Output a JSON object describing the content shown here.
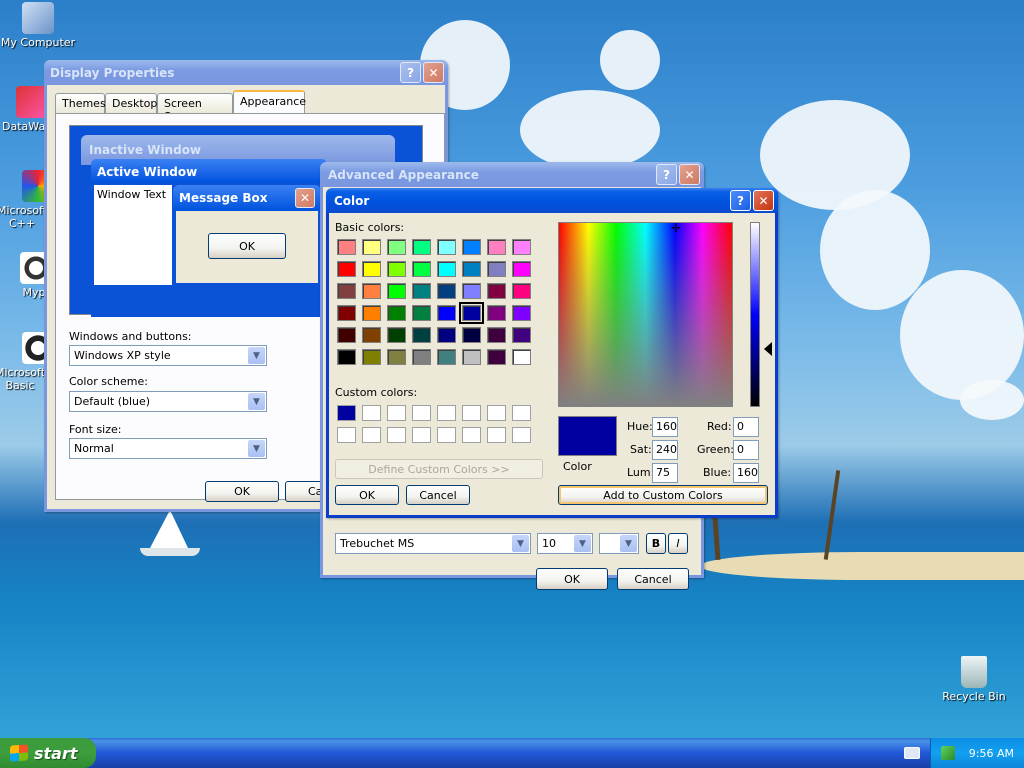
{
  "desktop": {
    "icons": [
      {
        "label": "My Computer"
      },
      {
        "label": "DataWa"
      },
      {
        "label": "Microsoft C++"
      },
      {
        "label": "Myp"
      },
      {
        "label": "Microsoft Basic"
      },
      {
        "label": "Recycle Bin"
      }
    ]
  },
  "display_properties": {
    "title": "Display Properties",
    "tabs": [
      "Themes",
      "Desktop",
      "Screen Saver",
      "Appearance"
    ],
    "active_tab": "Appearance",
    "preview": {
      "inactive_title": "Inactive Window",
      "active_title": "Active Window",
      "window_text": "Window Text",
      "message_box_title": "Message Box",
      "message_ok": "OK"
    },
    "windows_buttons_label": "Windows and buttons:",
    "windows_buttons_value": "Windows XP style",
    "color_scheme_label": "Color scheme:",
    "color_scheme_value": "Default (blue)",
    "font_size_label": "Font size:",
    "font_size_value": "Normal",
    "ok": "OK",
    "cancel": "Ca"
  },
  "advanced_appearance": {
    "title": "Advanced Appearance",
    "font_value": "Trebuchet MS",
    "size_value": "10",
    "bold": "B",
    "italic": "I",
    "ok": "OK",
    "cancel": "Cancel"
  },
  "color_dialog": {
    "title": "Color",
    "basic_colors_label": "Basic colors:",
    "basic_colors": [
      [
        "#ff8080",
        "#ffff80",
        "#80ff80",
        "#00ff80",
        "#80ffff",
        "#0080ff",
        "#ff80c0",
        "#ff80ff"
      ],
      [
        "#ff0000",
        "#ffff00",
        "#80ff00",
        "#00ff40",
        "#00ffff",
        "#0080c0",
        "#8080c0",
        "#ff00ff"
      ],
      [
        "#804040",
        "#ff8040",
        "#00ff00",
        "#008080",
        "#004080",
        "#8080ff",
        "#800040",
        "#ff0080"
      ],
      [
        "#800000",
        "#ff8000",
        "#008000",
        "#008040",
        "#0000ff",
        "#0000a0",
        "#800080",
        "#8000ff"
      ],
      [
        "#400000",
        "#804000",
        "#004000",
        "#004040",
        "#000080",
        "#000040",
        "#400040",
        "#400080"
      ],
      [
        "#000000",
        "#808000",
        "#808040",
        "#808080",
        "#408080",
        "#c0c0c0",
        "#400040",
        "#ffffff"
      ]
    ],
    "selected_basic": "#0000a0",
    "custom_colors_label": "Custom colors:",
    "custom_colors": [
      "#0000a0",
      "#ffffff",
      "#ffffff",
      "#ffffff",
      "#ffffff",
      "#ffffff",
      "#ffffff",
      "#ffffff",
      "#ffffff",
      "#ffffff",
      "#ffffff",
      "#ffffff",
      "#ffffff",
      "#ffffff",
      "#ffffff",
      "#ffffff"
    ],
    "define_custom": "Define Custom Colors >>",
    "ok": "OK",
    "cancel": "Cancel",
    "color_label": "Color",
    "current_color": "#0000a0",
    "hue_label": "Hue:",
    "hue": "160",
    "sat_label": "Sat:",
    "sat": "240",
    "lum_label": "Lum:",
    "lum": "75",
    "red_label": "Red:",
    "red": "0",
    "green_label": "Green:",
    "green": "0",
    "blue_label": "Blue:",
    "blue": "160",
    "add_custom": "Add to Custom Colors"
  },
  "taskbar": {
    "start_label": "start",
    "clock": "9:56 AM"
  },
  "colors": {
    "xp_blue": "#0a3ec8",
    "dialog_bg": "#ece9d8",
    "start_green": "#3c9a3c"
  }
}
